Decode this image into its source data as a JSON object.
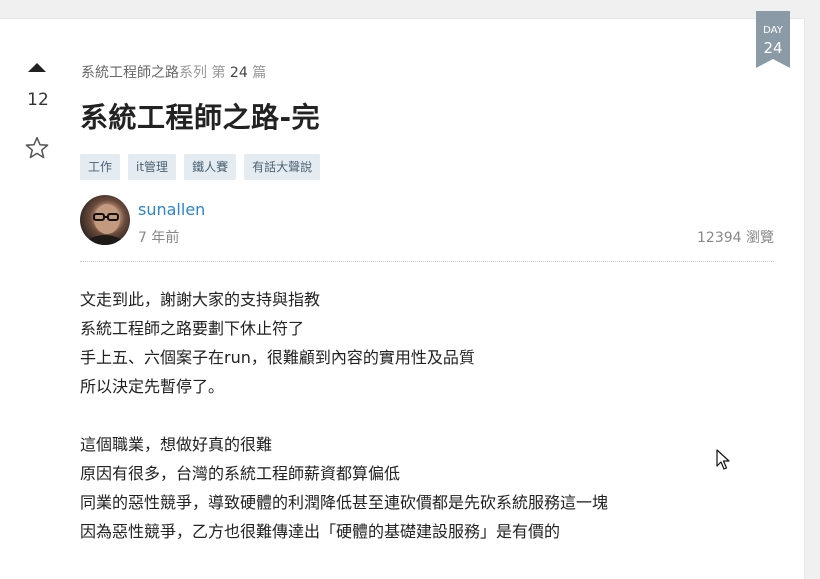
{
  "vote": {
    "count": "12"
  },
  "series": {
    "name": "系統工程師之路",
    "label_prefix": "系列",
    "label_di": "第",
    "number": "24",
    "label_pian": "篇"
  },
  "article": {
    "title": "系統工程師之路-完",
    "tags": [
      "工作",
      "it管理",
      "鐵人賽",
      "有話大聲說"
    ],
    "author": "sunallen",
    "posted": "7 年前",
    "views": "12394 瀏覽",
    "paragraphs": [
      [
        "文走到此，謝謝大家的支持與指教",
        "系統工程師之路要劃下休止符了",
        "手上五、六個案子在run，很難顧到內容的實用性及品質",
        "所以決定先暫停了。"
      ],
      [
        "這個職業，想做好真的很難",
        "原因有很多，台灣的系統工程師薪資都算偏低",
        "同業的惡性競爭，導致硬體的利潤降低甚至連砍價都是先砍系統服務這一塊",
        "因為惡性競爭，乙方也很難傳達出「硬體的基礎建設服務」是有價的"
      ]
    ]
  },
  "badge": {
    "label": "DAY",
    "day": "24",
    "color": "#8a9aa6"
  },
  "colors": {
    "link": "#2a86c9",
    "tag_bg": "#e4ecf1",
    "tag_text": "#4a6274"
  }
}
